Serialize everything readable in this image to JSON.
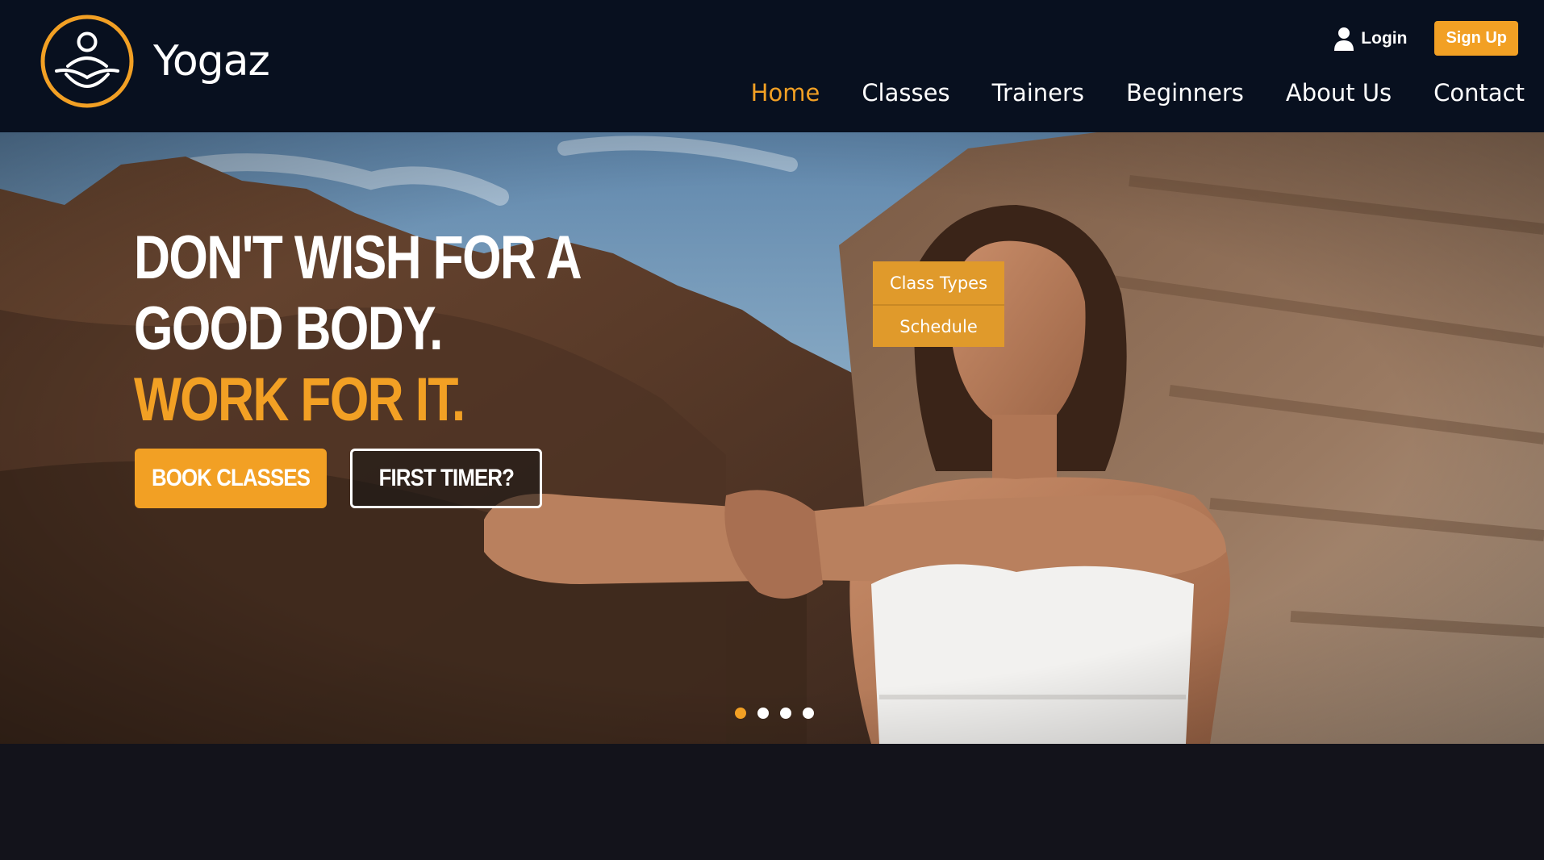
{
  "brand": {
    "name": "Yogaz"
  },
  "header_actions": {
    "login_label": "Login",
    "signup_label": "Sign Up"
  },
  "nav": {
    "items": [
      {
        "label": "Home",
        "active": true
      },
      {
        "label": "Classes",
        "active": false
      },
      {
        "label": "Trainers",
        "active": false
      },
      {
        "label": "Beginners",
        "active": false
      },
      {
        "label": "About Us",
        "active": false
      },
      {
        "label": "Contact",
        "active": false
      }
    ]
  },
  "classes_dropdown": {
    "items": [
      "Class Types",
      "Schedule"
    ]
  },
  "hero": {
    "headline_line1": "DON'T WISH FOR A",
    "headline_line2": "GOOD BODY.",
    "headline_line3": "WORK FOR IT.",
    "primary_cta": "BOOK CLASSES",
    "secondary_cta": "FIRST TIMER?",
    "slides_total": 4,
    "active_slide": 1
  },
  "colors": {
    "accent": "#f2a024",
    "header_bg": "#08101f",
    "page_bg": "#13131b",
    "dropdown_bg": "#e09a2b"
  },
  "icons": {
    "user": "user-icon",
    "logo": "meditation-logo-icon"
  }
}
